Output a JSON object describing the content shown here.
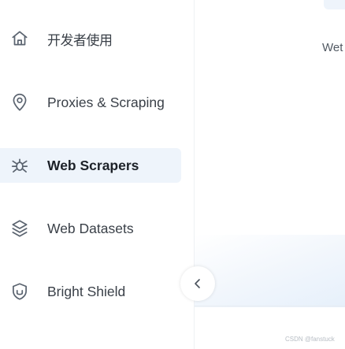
{
  "nav": {
    "items": [
      {
        "label": "开发者使用",
        "icon": "home-icon"
      },
      {
        "label": "Proxies & Scraping",
        "icon": "location-pin-icon"
      },
      {
        "label": "Web Scrapers",
        "icon": "spider-icon",
        "active": true
      },
      {
        "label": "Web Datasets",
        "icon": "database-icon"
      },
      {
        "label": "Bright Shield",
        "icon": "shield-icon"
      }
    ],
    "collapse_icon": "chevron-left-icon"
  },
  "panel": {
    "title": "Wet"
  },
  "watermark": "CSDN @fanstuck",
  "colors": {
    "active_bg": "#eef4fb",
    "text": "#3a4048",
    "icon_stroke": "#5b6470",
    "accent": "#3d7fd8"
  }
}
